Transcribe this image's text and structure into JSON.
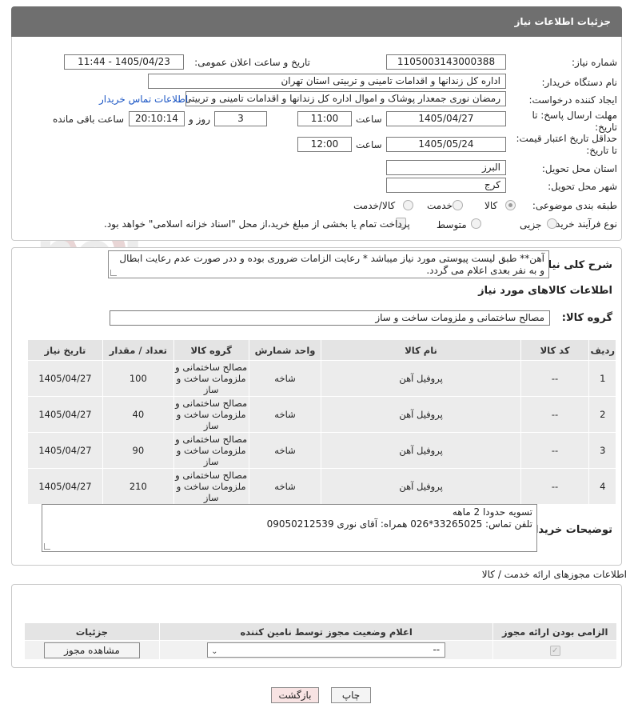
{
  "header": {
    "title": "جزئیات اطلاعات نیاز"
  },
  "need_number": {
    "label": "شماره نیاز:",
    "value": "1105003143000388"
  },
  "announce_datetime": {
    "label": "تاریخ و ساعت اعلان عمومی:",
    "value": "1405/04/23 - 11:44"
  },
  "buyer_org": {
    "label": "نام دستگاه خریدار:",
    "value": "اداره کل زندانها و اقدامات تامینی و تربیتی استان تهران"
  },
  "requester": {
    "label": "ایجاد کننده درخواست:",
    "value": "رمضان نوری جمعدار پوشاک و اموال  اداره کل زندانها و اقدامات تامینی و تربیتی استان تهران",
    "contact_link": "اطلاعات تماس خریدار"
  },
  "reply_deadline": {
    "label": "مهلت ارسال پاسخ: تا تاریخ:",
    "date": "1405/04/27",
    "time_label": "ساعت",
    "time": "11:00",
    "days": "3",
    "days_label": "روز و",
    "remaining": "20:10:14",
    "remaining_label": "ساعت باقی مانده"
  },
  "price_validity": {
    "label": "حداقل تاریخ اعتبار قیمت: تا تاریخ:",
    "date": "1405/05/24",
    "time_label": "ساعت",
    "time": "12:00"
  },
  "delivery_province": {
    "label": "استان محل تحویل:",
    "value": "البرز"
  },
  "delivery_city": {
    "label": "شهر محل تحویل:",
    "value": "کرج"
  },
  "category": {
    "label": "طبقه بندی موضوعی:",
    "options": [
      "کالا",
      "خدمت",
      "کالا/خدمت"
    ]
  },
  "purchase_process": {
    "label": "نوع فرآیند خرید :",
    "options": [
      "جزیی",
      "متوسط"
    ],
    "treasury_note": "پرداخت تمام یا بخشی از مبلغ خرید،از محل \"اسناد خزانه اسلامی\" خواهد بود."
  },
  "description": {
    "label": "شرح کلی نیاز:",
    "text": "آهن** طبق لیست پیوستی مورد نیاز میباشد * رعایت الزامات ضروری بوده و ددر صورت عدم رعایت ابطال و به نفر بعدی اعلام می گردد."
  },
  "goods_section": {
    "title": "اطلاعات کالاهای مورد نیاز"
  },
  "goods_group": {
    "label": "گروه کالا:",
    "value": "مصالح ساختمانی و ملزومات ساخت و ساز"
  },
  "items_table": {
    "headers": [
      "ردیف",
      "کد کالا",
      "نام کالا",
      "واحد شمارش",
      "گروه کالا",
      "تعداد / مقدار",
      "تاریخ نیاز"
    ],
    "rows": [
      {
        "row": "1",
        "code": "--",
        "name": "پروفیل آهن",
        "unit": "شاخه",
        "group": "مصالح ساختمانی و ملزومات ساخت و ساز",
        "qty": "100",
        "date": "1405/04/27"
      },
      {
        "row": "2",
        "code": "--",
        "name": "پروفیل آهن",
        "unit": "شاخه",
        "group": "مصالح ساختمانی و ملزومات ساخت و ساز",
        "qty": "40",
        "date": "1405/04/27"
      },
      {
        "row": "3",
        "code": "--",
        "name": "پروفیل آهن",
        "unit": "شاخه",
        "group": "مصالح ساختمانی و ملزومات ساخت و ساز",
        "qty": "90",
        "date": "1405/04/27"
      },
      {
        "row": "4",
        "code": "--",
        "name": "پروفیل آهن",
        "unit": "شاخه",
        "group": "مصالح ساختمانی و ملزومات ساخت و ساز",
        "qty": "210",
        "date": "1405/04/27"
      }
    ]
  },
  "buyer_notes": {
    "label": "توضیحات خریدار:",
    "line1": "تسویه حدودا 2 ماهه",
    "line2": "تلفن تماس: 33265025*026     همراه: آقای نوری 09050212539"
  },
  "permits": {
    "title": "اطلاعات مجوزهای ارائه خدمت / کالا",
    "headers": [
      "الزامی بودن ارائه مجوز",
      "اعلام وضعیت مجوز توسط نامین کننده",
      "جزئیات"
    ],
    "select_value": "--",
    "view_button": "مشاهده مجوز"
  },
  "footer": {
    "print_button": "چاپ",
    "back_button": "بازگشت"
  },
  "watermark": {
    "text": "AriaTender.neT"
  },
  "colors": {
    "header_bg": "#6f6f6f",
    "link": "#1a55c4",
    "back_button_bg": "#f8e3e3"
  }
}
